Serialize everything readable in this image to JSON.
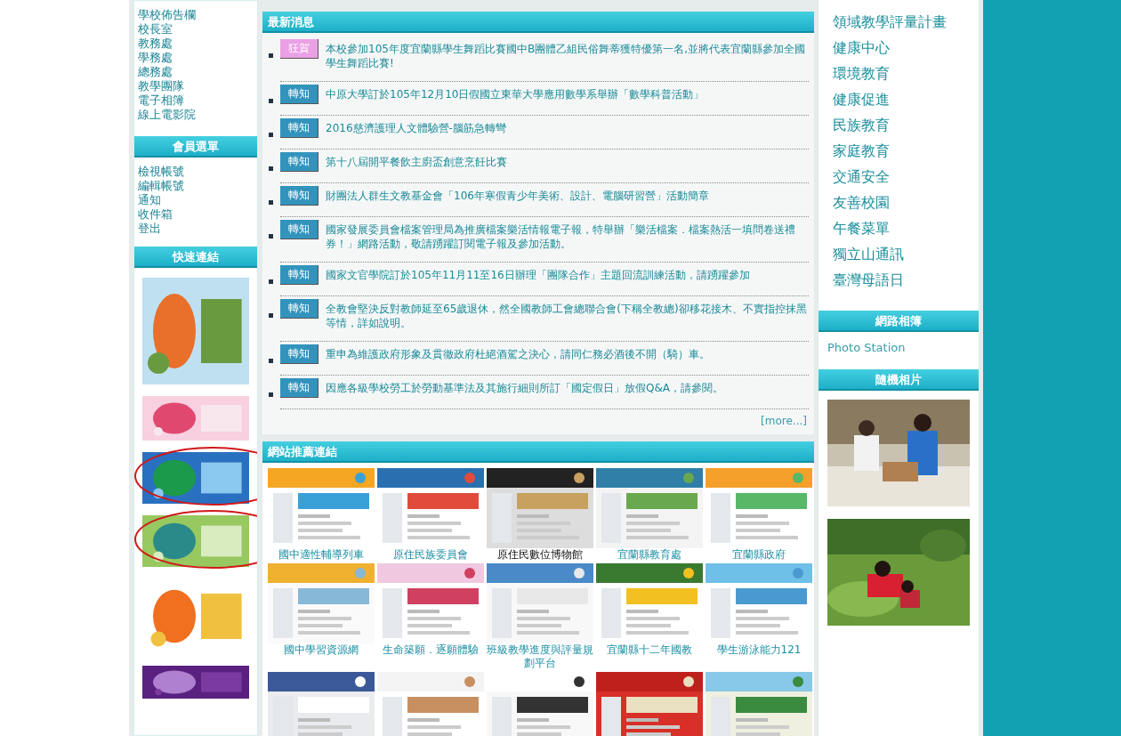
{
  "left_menu": {
    "items": [
      "學校佈告欄",
      "校長室",
      "教務處",
      "學務處",
      "總務處",
      "教學團隊",
      "電子相簿",
      "線上電影院"
    ]
  },
  "member_menu": {
    "title": "會員選單",
    "items": [
      "檢視帳號",
      "編輯帳號",
      "通知",
      "收件箱",
      "登出"
    ]
  },
  "quick_links": {
    "title": "快速連結",
    "banners": [
      {
        "kind": "picture",
        "circled": false
      },
      {
        "kind": "picture",
        "circled": false
      },
      {
        "kind": "picture",
        "circled": true
      },
      {
        "kind": "picture",
        "circled": true
      },
      {
        "kind": "picture",
        "circled": false
      },
      {
        "kind": "picture",
        "circled": false
      }
    ]
  },
  "news": {
    "title": "最新消息",
    "items": [
      {
        "kind": "congrats",
        "tag": "狂賀",
        "text": "本校參加105年度宜蘭縣學生舞蹈比賽國中B團體乙組民俗舞蒂獲特優第一名,並將代表宜蘭縣參加全國學生舞蹈比賽!"
      },
      {
        "kind": "notice",
        "tag": "轉知",
        "text": "中原大學訂於105年12月10日假國立東華大學應用數學系舉辦「數學科普活動」"
      },
      {
        "kind": "notice",
        "tag": "轉知",
        "text": "2016慈濟護理人文體驗營-腦筋急轉彎"
      },
      {
        "kind": "notice",
        "tag": "轉知",
        "text": "第十八屆開平餐飲主廚盃創意烹飪比賽"
      },
      {
        "kind": "notice",
        "tag": "轉知",
        "text": "財團法人群生文教基金會「106年寒假青少年美術、設計、電腦研習營」活動簡章"
      },
      {
        "kind": "notice",
        "tag": "轉知",
        "text": "國家發展委員會檔案管理局為推廣檔案樂活情報電子報，特舉辦「樂活檔案．檔案熱活一填問卷送禮券！」網路活動，敬請踴躍訂閱電子報及參加活動。"
      },
      {
        "kind": "notice",
        "tag": "轉知",
        "text": "國家文官學院訂於105年11月11至16日辦理「團隊合作」主題回流訓練活動，請踴躍參加"
      },
      {
        "kind": "notice",
        "tag": "轉知",
        "text": "全教會堅決反對教師延至65歲退休，然全國教師工會總聯合會(下稱全教總)卻移花接木、不實指控抹黑等情，詳如說明。"
      },
      {
        "kind": "notice",
        "tag": "轉知",
        "text": "重申為維護政府形象及貫徹政府杜絕酒駕之決心，請同仁務必酒後不開（騎）車。"
      },
      {
        "kind": "notice",
        "tag": "轉知",
        "text": "因應各級學校勞工於勞動基準法及其施行細則所訂「國定假日」放假Q&A，請參閱。"
      }
    ],
    "more": "[more...]"
  },
  "recommended": {
    "title": "網站推薦連結",
    "sites": [
      {
        "caption": "國中適性輔導列車",
        "visited": false
      },
      {
        "caption": "原住民族委員會",
        "visited": false
      },
      {
        "caption": "原住民數位博物館",
        "visited": true
      },
      {
        "caption": "宜蘭縣教育處",
        "visited": false
      },
      {
        "caption": "宜蘭縣政府",
        "visited": false
      },
      {
        "caption": "國中學習資源網",
        "visited": false
      },
      {
        "caption": "生命築願．逐願體驗",
        "visited": false
      },
      {
        "caption": "班級教學進度與評量規劃平台",
        "visited": false
      },
      {
        "caption": "宜蘭縣十二年國教",
        "visited": false
      },
      {
        "caption": "學生游泳能力121",
        "visited": false
      },
      {
        "kind": "picture"
      },
      {
        "kind": "picture"
      },
      {
        "kind": "picture"
      },
      {
        "kind": "picture"
      },
      {
        "kind": "picture"
      }
    ]
  },
  "right_menu": {
    "items": [
      "領域教學評量計畫",
      "健康中心",
      "環境教育",
      "健康促進",
      "民族教育",
      "家庭教育",
      "交通安全",
      "友善校園",
      "午餐菜單",
      "獨立山通訊",
      "臺灣母語日"
    ]
  },
  "album": {
    "title": "網路相簿",
    "items": [
      "Photo Station"
    ]
  },
  "random_photos": {
    "title": "隨機相片",
    "photos": [
      {
        "kind": "picture"
      },
      {
        "kind": "picture"
      }
    ]
  }
}
